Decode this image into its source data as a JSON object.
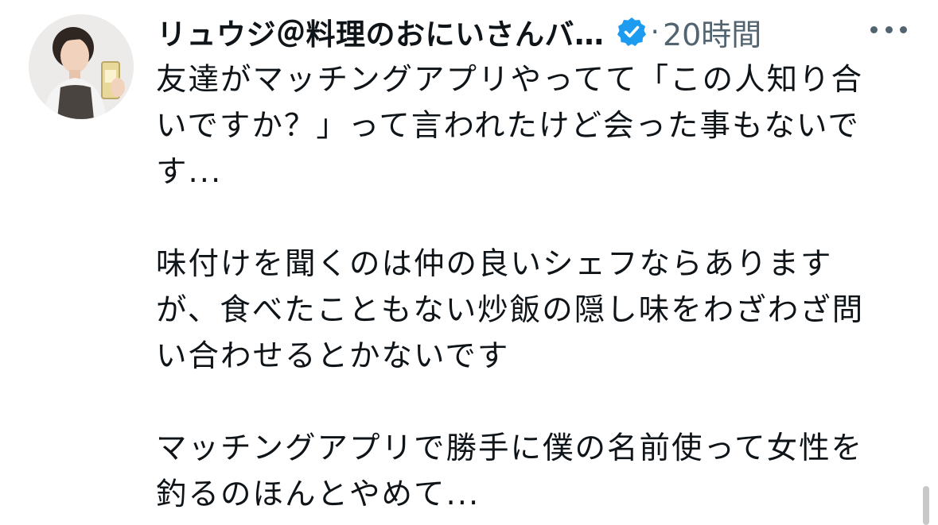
{
  "tweet": {
    "author": {
      "display_name": "リュウジ＠料理のおにいさんバ…",
      "verified_icon": "verified-badge-icon",
      "avatar": "avatar-photo"
    },
    "separator": "·",
    "timestamp": "20時間",
    "more_icon": "more-options-icon",
    "paragraphs": [
      "友達がマッチングアプリやってて「この人知り合\nいですか？」って言われたけど会った事もないで\nす...",
      "味付けを聞くのは仲の良いシェフならあります\nが、食べたこともない炒飯の隠し味をわざわざ問\nい合わせるとかないです",
      "マッチングアプリで勝手に僕の名前使って女性を\n釣るのほんとやめて..."
    ]
  },
  "colors": {
    "text_primary": "#0f1419",
    "text_secondary": "#536471",
    "verified_blue": "#1d9bf0",
    "background": "#ffffff"
  }
}
